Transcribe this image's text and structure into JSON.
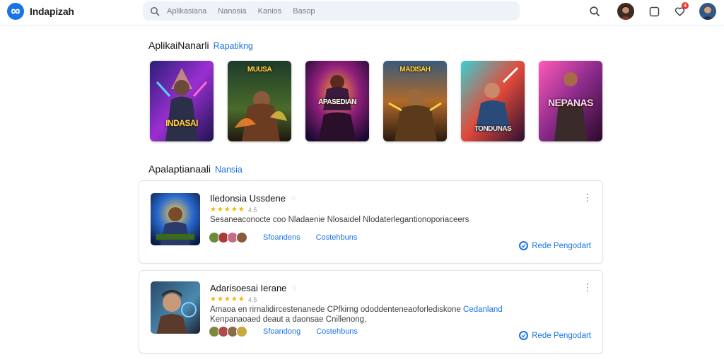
{
  "app": {
    "name": "Indapizah"
  },
  "search": {
    "tags": [
      "Aplikasiana",
      "Nanosia",
      "Kanios",
      "Basop"
    ]
  },
  "header": {
    "badge_count": "4",
    "icons": [
      "search-icon",
      "avatar",
      "square-icon",
      "heart-icon",
      "avatar"
    ]
  },
  "featured": {
    "title": "AplikaiNanarli",
    "link": "Rapatikng",
    "items": [
      {
        "caption": "INDASAI"
      },
      {
        "caption": "MUUSA"
      },
      {
        "caption": "APASEDIAN"
      },
      {
        "caption": "MADISAH"
      },
      {
        "caption": "TONDUNAS"
      },
      {
        "caption": "NEPANAS"
      }
    ]
  },
  "recommended": {
    "title": "Apalaptianaali",
    "link": "Nansia"
  },
  "list": [
    {
      "title": "Iledonsia Ussdene",
      "rating_text": "★★★★★",
      "rating_count": "4.5",
      "description": "Sesaneaconocte coo Nladaenie Nlosaidel Nlodaterlegantionoporiaceers",
      "description_highlight": "",
      "foot_link_1": "Sfoandens",
      "foot_link_2": "Costehbuns",
      "cta": "Rede Pengodart"
    },
    {
      "title": "Adarisoesai Ierane",
      "rating_text": "★★★★★",
      "rating_count": "4.5",
      "description": "Amaoa en rirnalidircestenanede CPfkirng ododdenteneaoforlediskone",
      "description_highlight": "Cedanland",
      "description_line2": "Kenpanaoaed deaut a daonsae Cnillenong,",
      "foot_link_1": "Sfoandong",
      "foot_link_2": "Costehbuns",
      "cta": "Rede Pengodart"
    }
  ],
  "colors": {
    "accent": "#1a73e8",
    "star": "#f4b400",
    "badge": "#e53935"
  }
}
